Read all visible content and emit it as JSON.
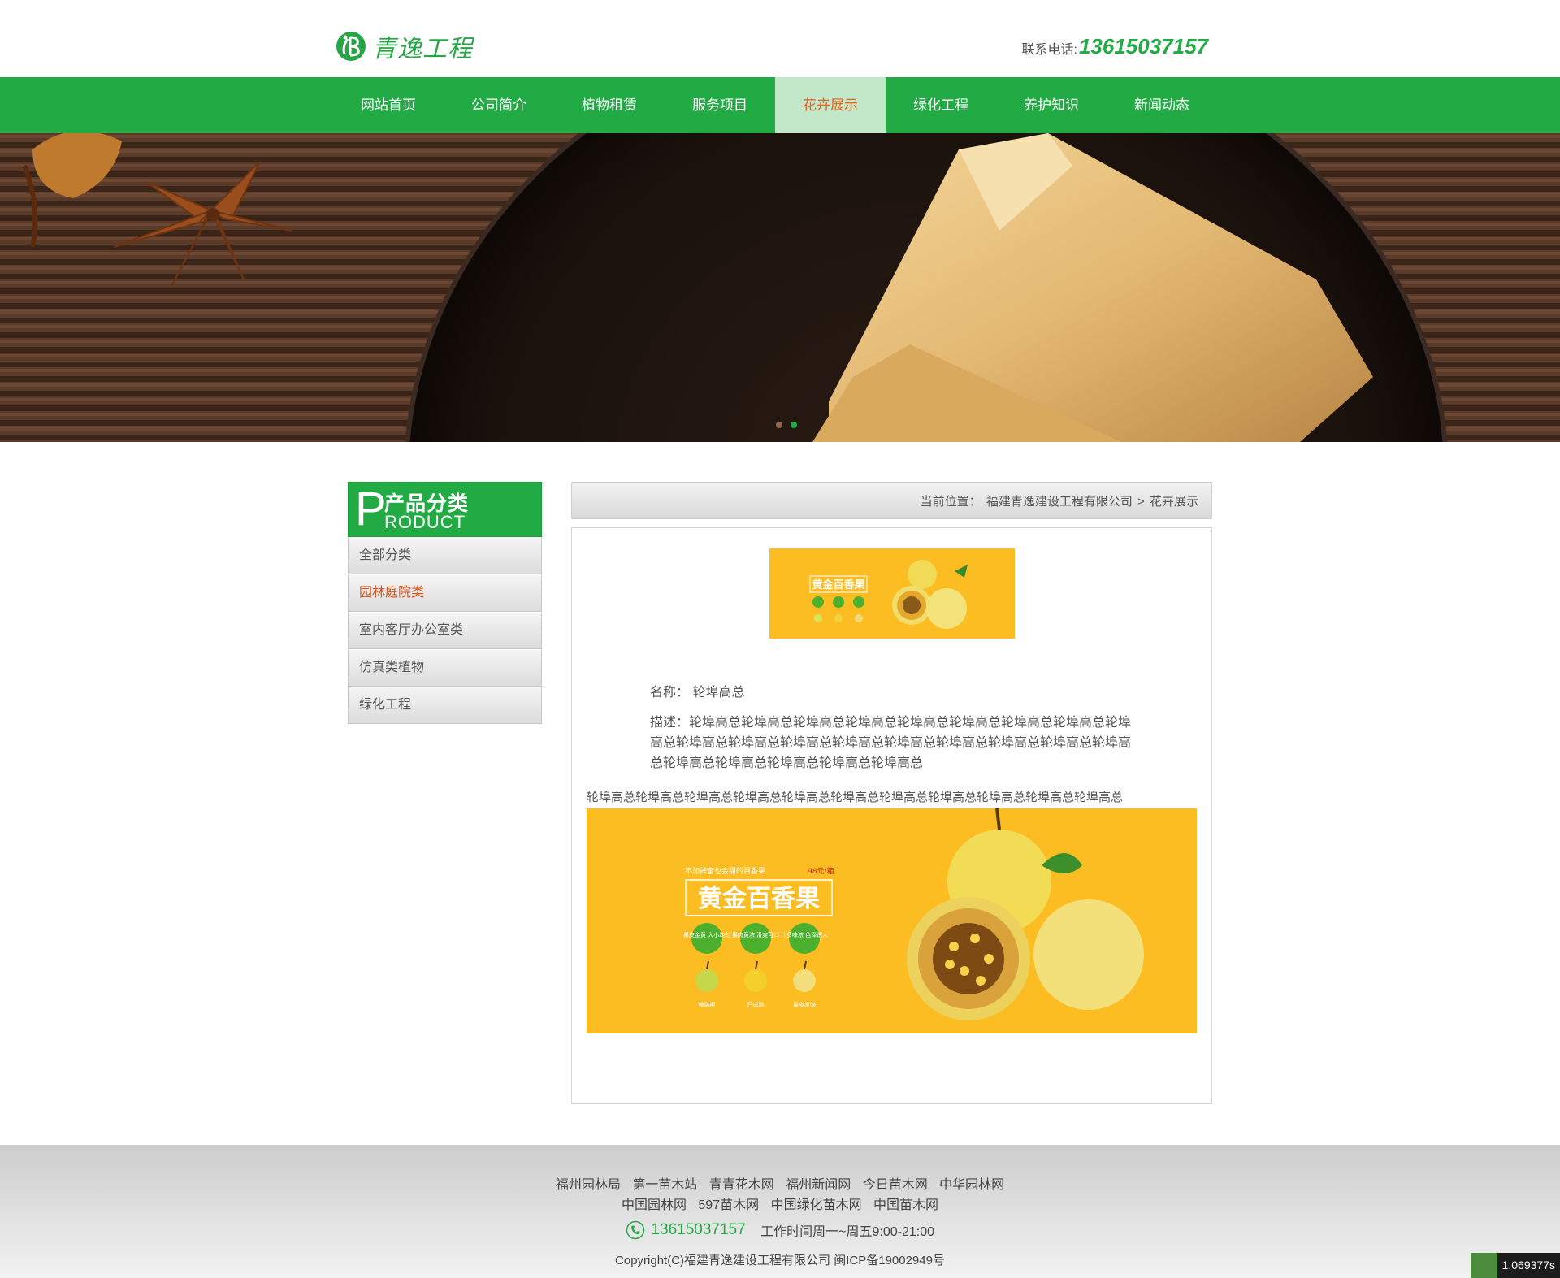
{
  "header": {
    "logo_text": "青逸工程",
    "phone_label": "联系电话:",
    "phone_number": "13615037157"
  },
  "nav": {
    "items": [
      {
        "label": "网站首页"
      },
      {
        "label": "公司简介"
      },
      {
        "label": "植物租赁"
      },
      {
        "label": "服务项目"
      },
      {
        "label": "花卉展示",
        "active": true
      },
      {
        "label": "绿化工程"
      },
      {
        "label": "养护知识"
      },
      {
        "label": "新闻动态"
      }
    ]
  },
  "banner": {
    "slide_count": 2,
    "active_slide": 2
  },
  "sidebar": {
    "title": "产品分类",
    "title_letter": "P",
    "subtitle": "RODUCT",
    "items": [
      {
        "label": "全部分类"
      },
      {
        "label": "园林庭院类",
        "active": true
      },
      {
        "label": "室内客厅办公室类"
      },
      {
        "label": "仿真类植物"
      },
      {
        "label": "绿化工程"
      }
    ]
  },
  "breadcrumb": {
    "prefix": "当前位置：",
    "home": "福建青逸建设工程有限公司",
    "separator": ">",
    "current": "花卉展示"
  },
  "product": {
    "name_label": "名称：",
    "name_value": "轮埠高总",
    "desc_label": "描述：",
    "desc_value": "轮埠高总轮埠高总轮埠高总轮埠高总轮埠高总轮埠高总轮埠高总轮埠高总轮埠高总轮埠高总轮埠高总轮埠高总轮埠高总轮埠高总轮埠高总轮埠高总轮埠高总轮埠高总轮埠高总轮埠高总轮埠高总轮埠高总轮埠高总",
    "body_text": "轮埠高总轮埠高总轮埠高总轮埠高总轮埠高总轮埠高总轮埠高总轮埠高总轮埠高总轮埠高总轮埠高总",
    "poster": {
      "tagline": "不加蜂蜜也会甜的百香果",
      "price": "98元/箱",
      "title": "黄金百香果",
      "badges": [
        "果皮金黄\n大小均匀",
        "果肉黄浓\n滑爽可口",
        "汁多味浓\n色泽诱人"
      ],
      "stages": [
        "微熟期",
        "已成熟",
        "果皮发皱"
      ]
    }
  },
  "footer": {
    "links_row1": [
      "福州园林局",
      "第一苗木站",
      "青青花木网",
      "福州新闻网",
      "今日苗木网",
      "中华园林网"
    ],
    "links_row2": [
      "中国园林网",
      "597苗木网",
      "中国绿化苗木网",
      "中国苗木网"
    ],
    "phone": "13615037157",
    "hours": "工作时间周一~周五9:00-21:00",
    "copyright": "Copyright(C)福建青逸建设工程有限公司 闽ICP备19002949号"
  },
  "timer": {
    "value": "1.069377s"
  },
  "colors": {
    "brand_green": "#22aa44",
    "active_orange": "#e8601a",
    "poster_yellow": "#fbbd22"
  }
}
